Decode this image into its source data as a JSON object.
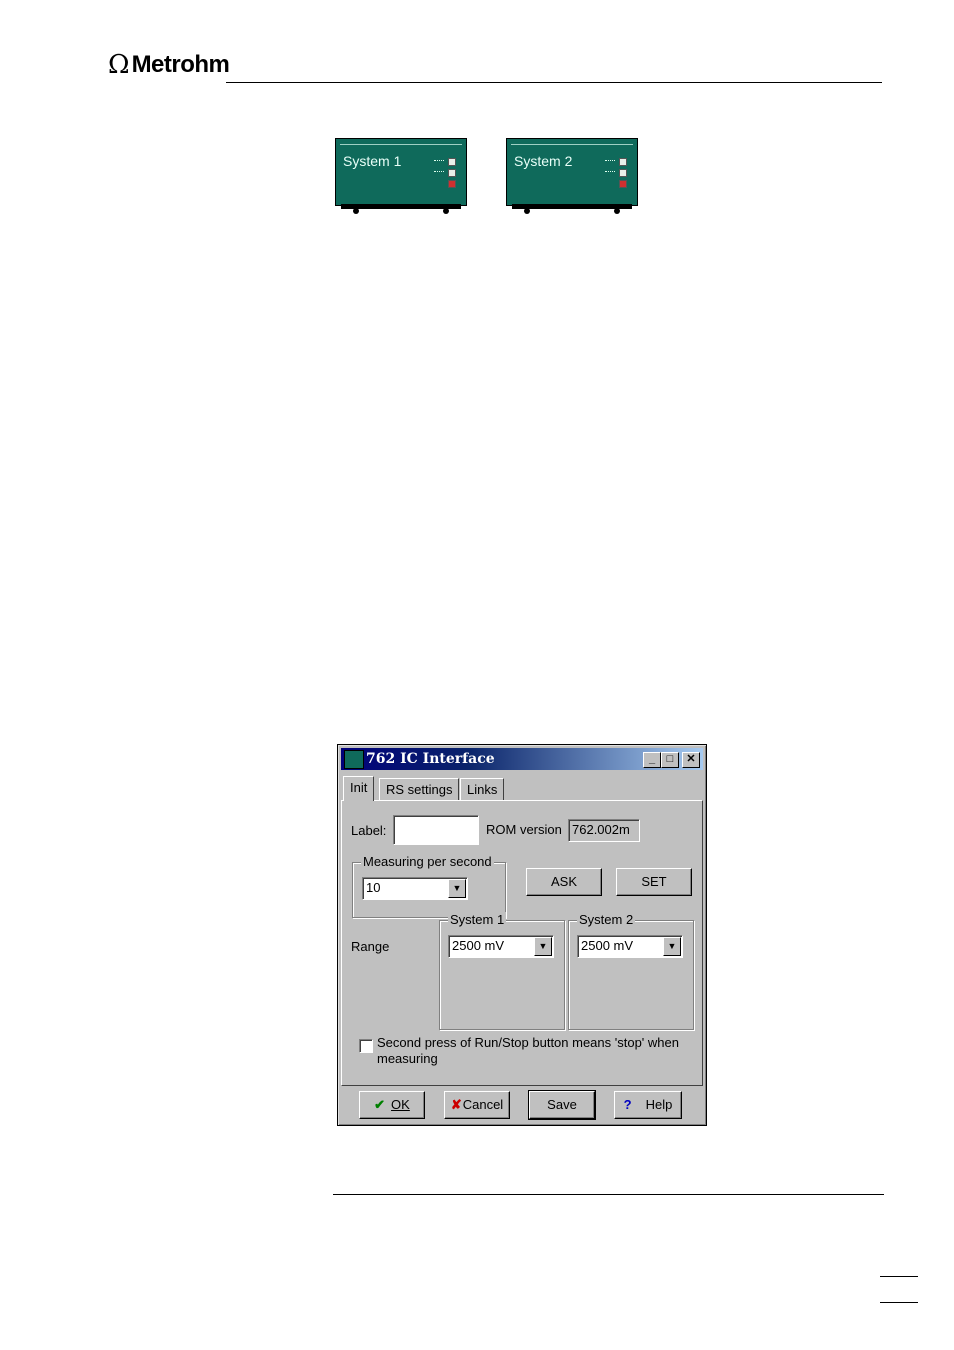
{
  "header": {
    "brand": "Metrohm",
    "omega": "Ω"
  },
  "instruments": [
    {
      "label": "System 1"
    },
    {
      "label": "System 2"
    }
  ],
  "dialog": {
    "title": "762 IC Interface",
    "window_buttons": {
      "minimize": "_",
      "maximize": "□",
      "close": "✕"
    },
    "tabs": [
      "Init",
      "RS settings",
      "Links"
    ],
    "active_tab": "Init",
    "label_caption": "Label:",
    "label_value": "",
    "rom_caption": "ROM version",
    "rom_value": "762.002m",
    "measuring_group": "Measuring per second",
    "measuring_value": "10",
    "ask_label": "ASK",
    "set_label": "SET",
    "range_caption": "Range",
    "system1_group": "System 1",
    "system1_value": "2500 mV",
    "system2_group": "System 2",
    "system2_value": "2500 mV",
    "checkbox_label_line1": "Second press of Run/Stop button means 'stop' when",
    "checkbox_label_line2": "measuring",
    "checkbox_checked": false,
    "buttons": {
      "ok": "OK",
      "cancel": "Cancel",
      "save": "Save",
      "help": "Help"
    }
  },
  "colors": {
    "instrument_green": "#0f6a5b",
    "title_bar_start": "#00007b",
    "title_bar_end": "#a6caf0",
    "dialog_face": "#c0c0c0"
  }
}
